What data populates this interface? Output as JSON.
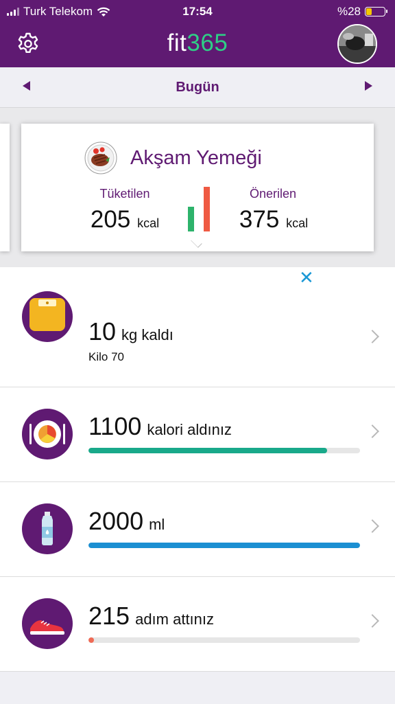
{
  "status_bar": {
    "carrier": "Turk Telekom",
    "time": "17:54",
    "battery_text": "%28",
    "battery_level": 0.28
  },
  "header": {
    "logo_text": "fit",
    "logo_number": "365"
  },
  "date_bar": {
    "title": "Bugün"
  },
  "meal_card": {
    "title": "Akşam Yemeği",
    "consumed_label": "Tüketilen",
    "consumed_value": "205",
    "consumed_unit": "kcal",
    "recommended_label": "Önerilen",
    "recommended_value": "375",
    "recommended_unit": "kcal"
  },
  "rows": [
    {
      "value": "10",
      "unit": "kg kaldı",
      "sub": "Kilo 70"
    },
    {
      "value": "1100",
      "unit": "kalori aldınız",
      "progress": 0.88,
      "color": "#19a98a"
    },
    {
      "value": "2000",
      "unit": "ml",
      "progress": 1.0,
      "color": "#1b8fd2"
    },
    {
      "value": "215",
      "unit": "adım attınız",
      "progress": 0.02,
      "color": "#ef6a55"
    }
  ],
  "colors": {
    "brand": "#5f1a72",
    "accent": "#2ecf86",
    "close": "#1a98d5"
  }
}
